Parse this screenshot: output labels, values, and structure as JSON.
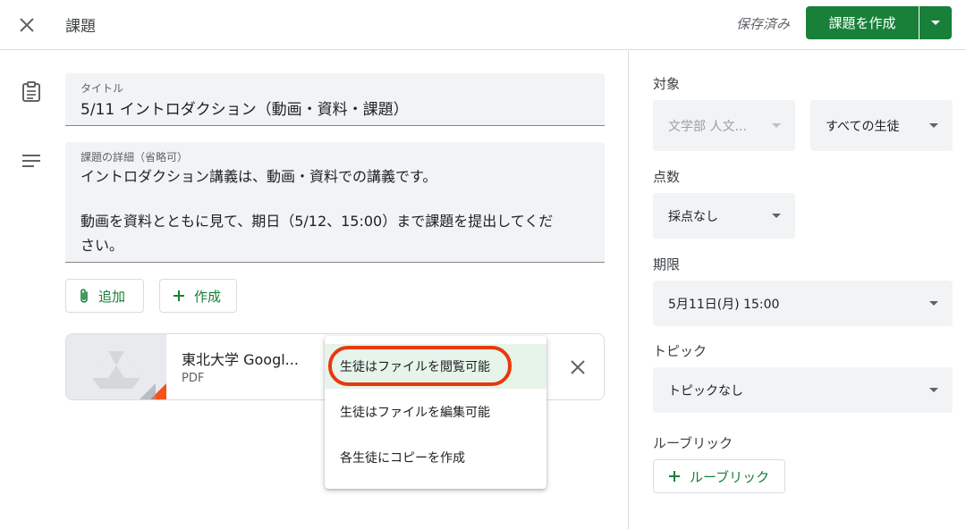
{
  "header": {
    "title": "課題",
    "saved_status": "保存済み",
    "create_label": "課題を作成"
  },
  "form": {
    "title_label": "タイトル",
    "title_value": "5/11 イントロダクション（動画・資料・課題）",
    "details_label": "課題の詳細（省略可）",
    "details_lines": [
      "イントロダクション講義は、動画・資料での講義です。",
      "",
      "動画を資料とともに見て、期日（5/12、15:00）まで課題を提出してくだ",
      "さい。"
    ],
    "add_label": "追加",
    "create_label": "作成"
  },
  "attachment": {
    "name": "東北大学 Googl...",
    "type": "PDF"
  },
  "share_menu": {
    "items": [
      "生徒はファイルを閲覧可能",
      "生徒はファイルを編集可能",
      "各生徒にコピーを作成"
    ],
    "selected_index": 0,
    "highlight_color": "#e8380d"
  },
  "side": {
    "target_label": "対象",
    "class_value": "文学部 人文...",
    "students_value": "すべての生徒",
    "points_label": "点数",
    "points_value": "採点なし",
    "due_label": "期限",
    "due_value": "5月11日(月) 15:00",
    "topic_label": "トピック",
    "topic_value": "トピックなし",
    "rubric_label": "ルーブリック",
    "rubric_button": "ルーブリック"
  },
  "colors": {
    "brand_green": "#188038",
    "highlight": "#e8380d"
  },
  "icons": {
    "close": "close-icon",
    "assignment": "clipboard-icon",
    "details": "notes-icon",
    "attach": "paperclip-icon",
    "add": "plus-icon",
    "drive": "google-drive-icon",
    "dropdown": "caret-down-icon"
  }
}
